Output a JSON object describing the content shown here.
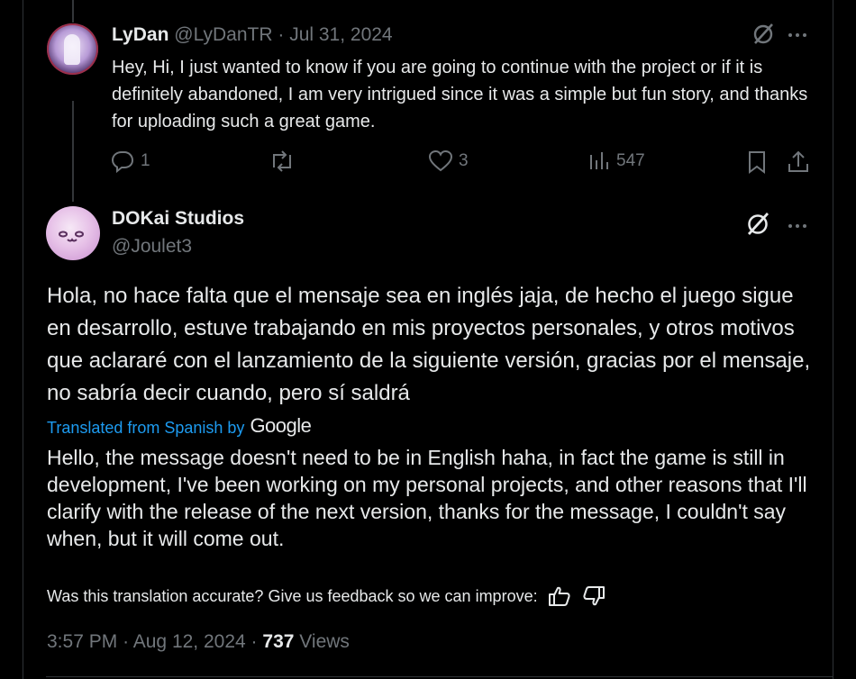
{
  "reply": {
    "name": "LyDan",
    "handle": "@LyDanTR",
    "separator": "·",
    "date": "Jul 31, 2024",
    "text": "Hey, Hi, I just wanted to know if you are going to continue with the project or if it is definitely abandoned, I am very intrigued since it was a simple but fun story, and thanks for uploading such a great game.",
    "reply_count": "1",
    "like_count": "3",
    "view_count": "547"
  },
  "main": {
    "name": "DOKai Studios",
    "handle": "@Joulet3",
    "text": "Hola, no hace falta que el mensaje sea en inglés jaja, de hecho el juego sigue en desarrollo, estuve trabajando en mis proyectos personales, y otros motivos que aclararé con el lanzamiento de la siguiente versión, gracias por el mensaje, no sabría decir cuando, pero sí saldrá",
    "translated_label": "Translated from Spanish by",
    "translator": "Google",
    "translation": "Hello, the message doesn't need to be in English haha, in fact the game is still in development, I've been working on my personal projects, and other reasons that I'll clarify with the release of the next version, thanks for the message, I couldn't say when, but it will come out.",
    "feedback_prompt": "Was this translation accurate? Give us feedback so we can improve:",
    "time": "3:57 PM",
    "separator": "·",
    "date": "Aug 12, 2024",
    "views": "737",
    "views_label": "Views"
  },
  "icons": {
    "grok": "grok-icon",
    "more": "more-icon",
    "reply": "reply-icon",
    "repost": "repost-icon",
    "like": "heart-icon",
    "views": "views-icon",
    "bookmark": "bookmark-icon",
    "share": "share-icon",
    "thumbs_up": "thumbs-up-icon",
    "thumbs_down": "thumbs-down-icon"
  },
  "colors": {
    "background": "#000000",
    "text": "#e7e9ea",
    "muted": "#71767b",
    "link": "#1d9bf0",
    "border": "#2f3336"
  }
}
